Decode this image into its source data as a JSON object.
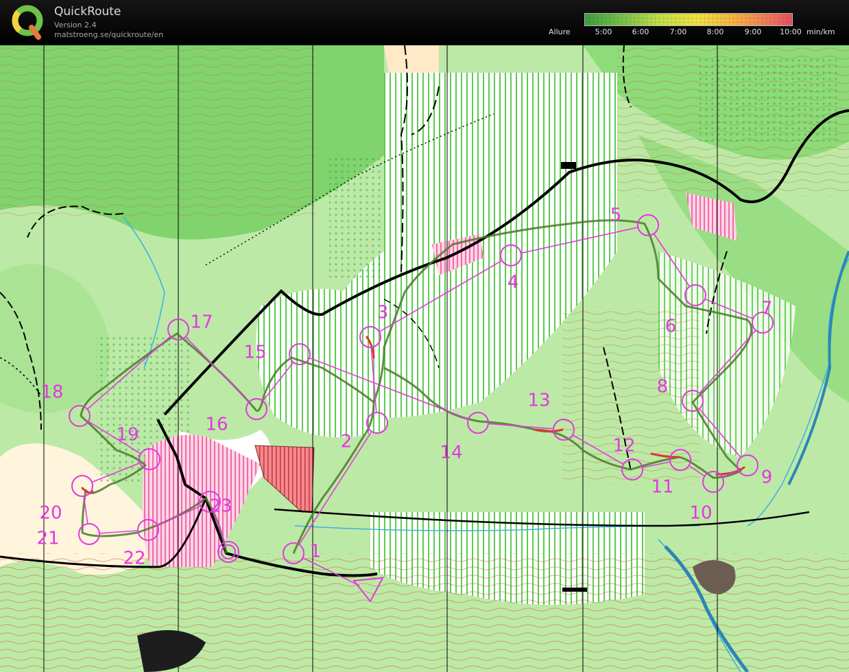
{
  "app": {
    "title": "QuickRoute",
    "version": "Version 2.4",
    "url": "matstroeng.se/quickroute/en"
  },
  "pace_scale": {
    "label": "Allure",
    "ticks": [
      "5:00",
      "6:00",
      "7:00",
      "8:00",
      "9:00",
      "10:00"
    ],
    "unit": "min/km",
    "colors": [
      "#3f9f3f",
      "#78c04a",
      "#c4de48",
      "#f2e343",
      "#f6b341",
      "#f07c5d",
      "#e84f63"
    ]
  },
  "map": {
    "course_color": "#e238e0",
    "route_color": "#4a7a2a",
    "start_label": "Start",
    "controls": [
      {
        "label": "1"
      },
      {
        "label": "2"
      },
      {
        "label": "3"
      },
      {
        "label": "4"
      },
      {
        "label": "5"
      },
      {
        "label": "6"
      },
      {
        "label": "7"
      },
      {
        "label": "8"
      },
      {
        "label": "9"
      },
      {
        "label": "10"
      },
      {
        "label": "11"
      },
      {
        "label": "12"
      },
      {
        "label": "13"
      },
      {
        "label": "14"
      },
      {
        "label": "15"
      },
      {
        "label": "16"
      },
      {
        "label": "17"
      },
      {
        "label": "18"
      },
      {
        "label": "19"
      },
      {
        "label": "20"
      },
      {
        "label": "21"
      },
      {
        "label": "22"
      },
      {
        "label": "23"
      }
    ],
    "finish_label": "Finish"
  }
}
